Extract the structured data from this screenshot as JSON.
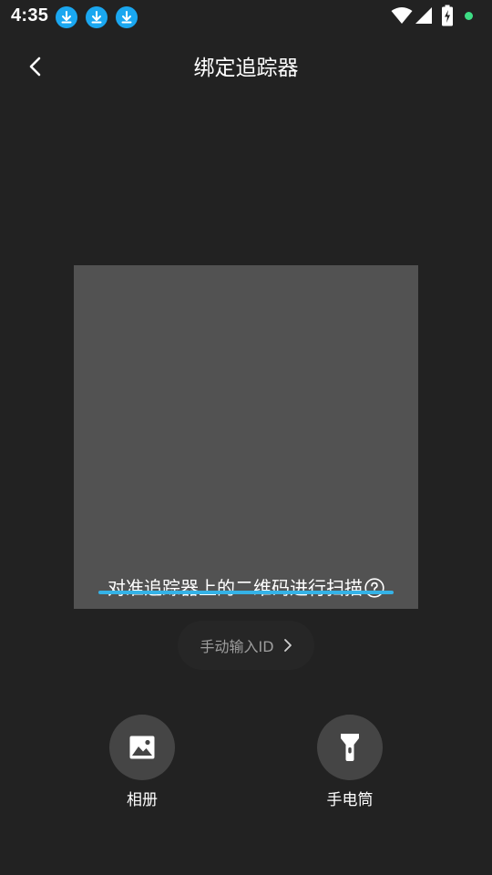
{
  "status_bar": {
    "time": "4:35",
    "icons": [
      "download-icon",
      "download-icon",
      "download-icon",
      "wifi-icon",
      "cellular-signal-icon",
      "battery-charging-icon",
      "notification-dot"
    ],
    "accent_download": "#1aa7f0",
    "dot_color": "#3ddc84"
  },
  "header": {
    "back_icon": "chevron-left-icon",
    "title": "绑定追踪器"
  },
  "scanner": {
    "hint": "对准追踪器上的二维码进行扫描",
    "help_icon": "question-circle-icon",
    "line_color": "#35b2e6"
  },
  "manual_entry": {
    "label": "手动输入ID",
    "icon": "chevron-right-icon"
  },
  "actions": [
    {
      "label": "相册",
      "icon": "image-icon"
    },
    {
      "label": "手电筒",
      "icon": "flashlight-icon"
    }
  ],
  "colors": {
    "background": "#222222",
    "scan_area": "#525252",
    "action_circle": "#454545"
  }
}
